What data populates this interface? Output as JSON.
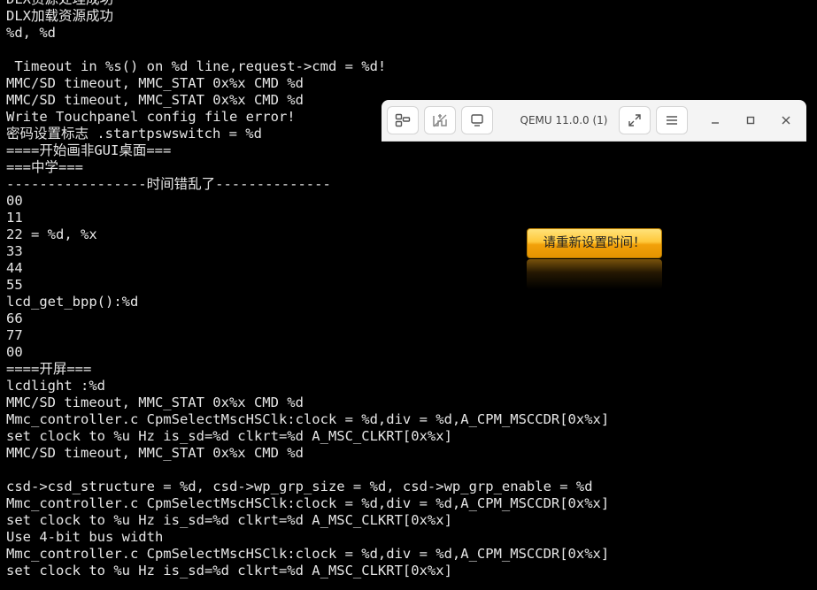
{
  "terminal": {
    "lines": [
      "DLX资源处理成功",
      "DLX加载资源成功",
      "%d, %d",
      "",
      " Timeout in %s() on %d line,request->cmd = %d!",
      "MMC/SD timeout, MMC_STAT 0x%x CMD %d",
      "MMC/SD timeout, MMC_STAT 0x%x CMD %d",
      "Write Touchpanel config file error!",
      "密码设置标志 .startpswswitch = %d",
      "====开始画非GUI桌面===",
      "===中学===",
      "-----------------时间错乱了--------------",
      "00",
      "11",
      "22 = %d, %x",
      "33",
      "44",
      "55",
      "lcd_get_bpp():%d",
      "66",
      "77",
      "00",
      "====开屏===",
      "lcdlight :%d",
      "MMC/SD timeout, MMC_STAT 0x%x CMD %d",
      "Mmc_controller.c CpmSelectMscHSClk:clock = %d,div = %d,A_CPM_MSCCDR[0x%x]",
      "set clock to %u Hz is_sd=%d clkrt=%d A_MSC_CLKRT[0x%x]",
      "MMC/SD timeout, MMC_STAT 0x%x CMD %d",
      "",
      "csd->csd_structure = %d, csd->wp_grp_size = %d, csd->wp_grp_enable = %d",
      "Mmc_controller.c CpmSelectMscHSClk:clock = %d,div = %d,A_CPM_MSCCDR[0x%x]",
      "set clock to %u Hz is_sd=%d clkrt=%d A_MSC_CLKRT[0x%x]",
      "Use 4-bit bus width",
      "Mmc_controller.c CpmSelectMscHSClk:clock = %d,div = %d,A_CPM_MSCCDR[0x%x]",
      "set clock to %u Hz is_sd=%d clkrt=%d A_MSC_CLKRT[0x%x]"
    ]
  },
  "qemu": {
    "title": "QEMU 11.0.0 (1)",
    "toolbar_icons": {
      "view": "view-icon",
      "keys": "keys-icon",
      "display": "display-icon",
      "fullscreen": "fullscreen-icon",
      "menu": "menu-icon",
      "minimize": "minimize-icon",
      "maximize": "maximize-icon",
      "close": "close-icon"
    },
    "guest": {
      "button_label": "请重新设置时间！"
    }
  },
  "colors": {
    "terminal_background": "#000000",
    "terminal_text": "#e6e6e6",
    "titlebar": "#f4f4f4",
    "button_gold": "#ffc83a"
  }
}
